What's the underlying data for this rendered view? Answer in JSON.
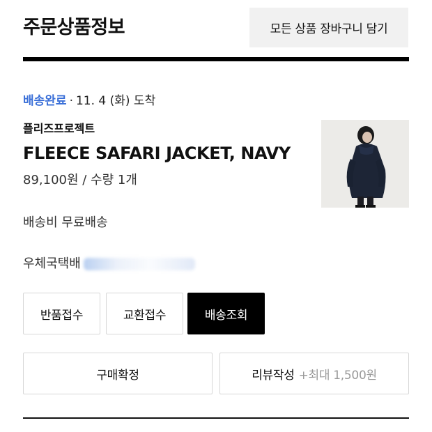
{
  "header": {
    "title": "주문상품정보",
    "cart_all_label": "모든 상품 장바구니 담기"
  },
  "order": {
    "status": "배송완료",
    "separator": "·",
    "arrival": "11. 4 (화) 도착",
    "brand": "플리즈프로젝트",
    "product_name": "FLEECE SAFARI JACKET, NAVY",
    "price_qty": "89,100원 / 수량 1개",
    "shipping_fee": "배송비 무료배송",
    "carrier": "우체국택배"
  },
  "actions": {
    "return_label": "반품접수",
    "exchange_label": "교환접수",
    "track_label": "배송조회",
    "confirm_label": "구매확정",
    "review_label": "리뷰작성",
    "review_bonus": "+최대 1,500원"
  },
  "colors": {
    "status_accent": "#3a6fd8",
    "primary_button": "#000000"
  }
}
